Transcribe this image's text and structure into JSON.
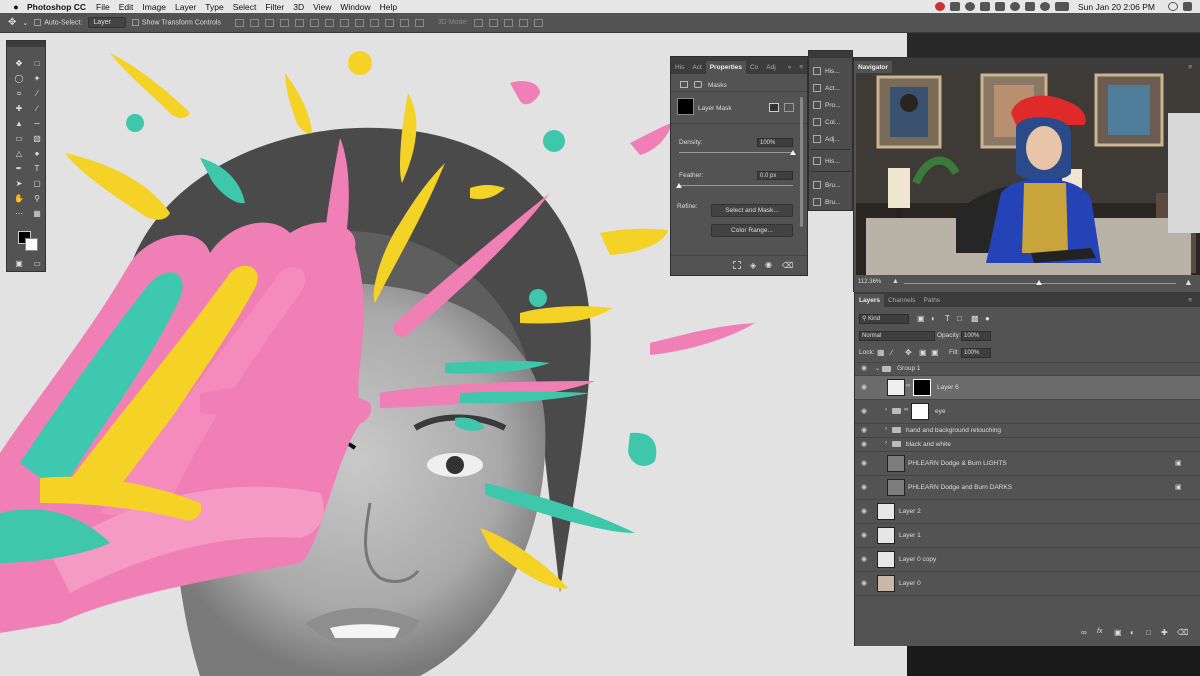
{
  "menubar": {
    "app_name": "Photoshop CC",
    "items": [
      "File",
      "Edit",
      "Image",
      "Layer",
      "Type",
      "Select",
      "Filter",
      "3D",
      "View",
      "Window",
      "Help"
    ],
    "clock": "Sun Jan 20  2:06 PM"
  },
  "options_bar": {
    "auto_select_label": "Auto-Select:",
    "auto_select_value": "Layer",
    "show_transform_label": "Show Transform Controls",
    "mode_3d_label": "3D Mode:"
  },
  "properties": {
    "tabs": [
      "His",
      "Act",
      "Properties",
      "Co",
      "Adj"
    ],
    "active_tab": "Properties",
    "masks_label": "Masks",
    "layer_mask_label": "Layer Mask",
    "density_label": "Density:",
    "density_value": "100%",
    "density_level": 1.0,
    "feather_label": "Feather:",
    "feather_value": "0.0 px",
    "feather_level": 0.0,
    "refine_label": "Refine:",
    "select_mask_button": "Select and Mask...",
    "color_range_button": "Color Range..."
  },
  "mini_panels": [
    "His...",
    "Act...",
    "Pro...",
    "Col...",
    "Adj...",
    "His...",
    "Bru...",
    "Bru..."
  ],
  "navigator": {
    "title": "Navigator",
    "zoom": "112.36%"
  },
  "layers_panel": {
    "tabs": [
      "Layers",
      "Channels",
      "Paths"
    ],
    "active_tab": "Layers",
    "filter_kind": "Kind",
    "blend_mode": "Normal",
    "opacity_label": "Opacity:",
    "opacity_value": "100%",
    "lock_label": "Lock:",
    "fill_label": "Fill:",
    "fill_value": "100%",
    "layers": [
      {
        "name": "Group 1",
        "kind": "group-open"
      },
      {
        "name": "Layer 6",
        "kind": "mask-layer"
      },
      {
        "name": "eye",
        "kind": "group-mask"
      },
      {
        "name": "hand and background retouching",
        "kind": "group"
      },
      {
        "name": "black and white",
        "kind": "group"
      },
      {
        "name": "PHLEARN Dodge & Burn LIGHTS",
        "kind": "adjustment"
      },
      {
        "name": "PHLEARN Dodge and Burn DARKS",
        "kind": "adjustment"
      },
      {
        "name": "Layer 2",
        "kind": "pixel"
      },
      {
        "name": "Layer 1",
        "kind": "pixel"
      },
      {
        "name": "Layer 0 copy",
        "kind": "pixel"
      },
      {
        "name": "Layer 0",
        "kind": "pixel"
      }
    ]
  },
  "colors": {
    "accent_pink": "#f27fb3",
    "accent_yellow": "#f5d324",
    "accent_teal": "#3fc7ac",
    "panel_bg": "#535353"
  }
}
